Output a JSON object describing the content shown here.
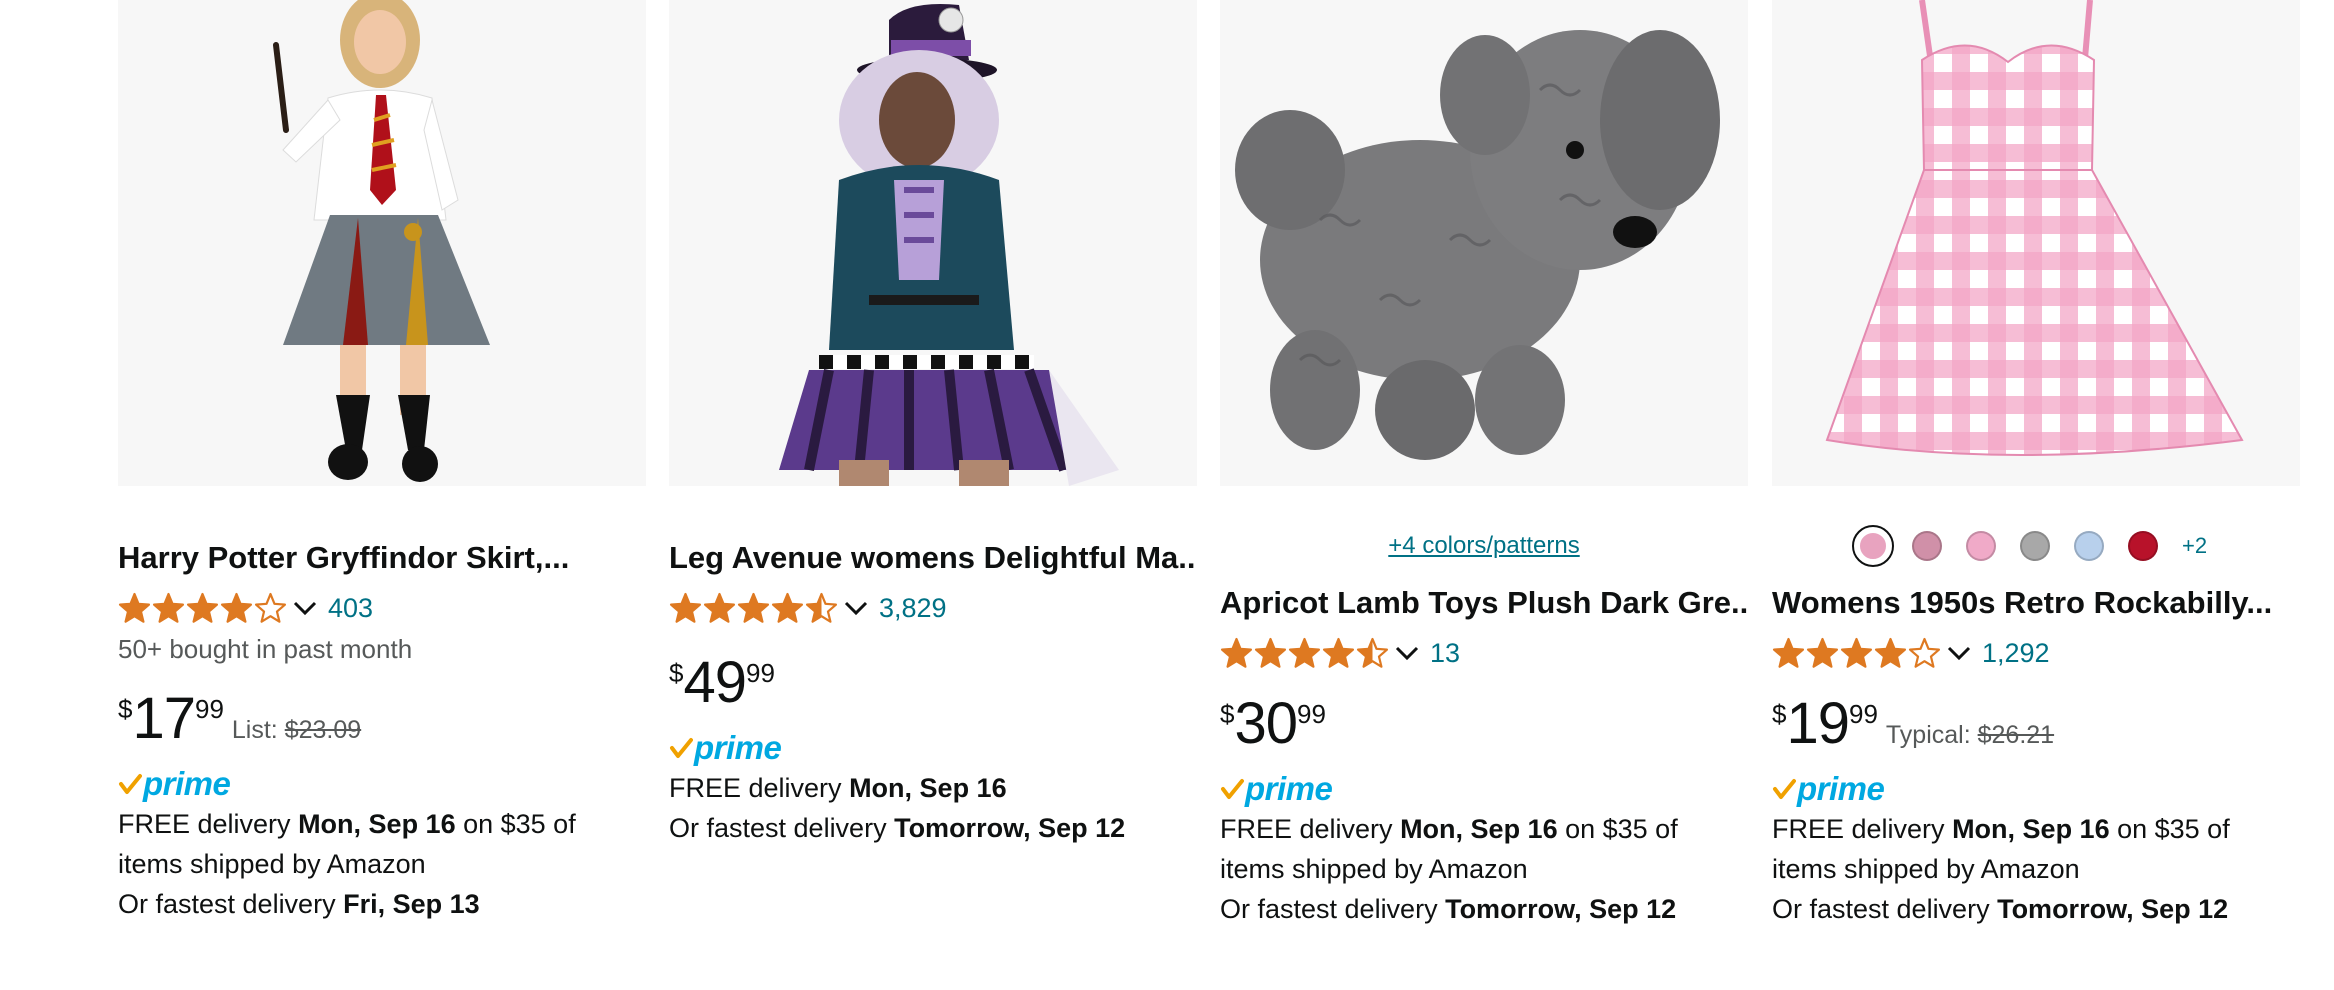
{
  "products": [
    {
      "title": "Harry Potter Gryffindor Skirt,...",
      "rating_value": 4.0,
      "rating_count": "403",
      "bought": "50+ bought in past month",
      "price_currency": "$",
      "price_whole": "17",
      "price_fraction": "99",
      "list_label": "List:",
      "list_price": "$23.09",
      "prime_label": "prime",
      "delivery_1_pre": "FREE delivery ",
      "delivery_1_bold": "Mon, Sep 16",
      "delivery_1_post": " on $35 of",
      "delivery_2": "items shipped by Amazon",
      "delivery_3_pre": "Or fastest delivery ",
      "delivery_3_bold": "Fri, Sep 13"
    },
    {
      "title": "Leg Avenue womens Delightful Ma...",
      "rating_value": 4.5,
      "rating_count": "3,829",
      "price_currency": "$",
      "price_whole": "49",
      "price_fraction": "99",
      "prime_label": "prime",
      "delivery_1_pre": "FREE delivery ",
      "delivery_1_bold": "Mon, Sep 16",
      "delivery_3_pre": "Or fastest delivery ",
      "delivery_3_bold": "Tomorrow, Sep 12"
    },
    {
      "colors_link": "+4 colors/patterns",
      "title": "Apricot Lamb Toys Plush Dark Gre...",
      "rating_value": 4.5,
      "rating_count": "13",
      "price_currency": "$",
      "price_whole": "30",
      "price_fraction": "99",
      "prime_label": "prime",
      "delivery_1_pre": "FREE delivery ",
      "delivery_1_bold": "Mon, Sep 16",
      "delivery_1_post": " on $35 of",
      "delivery_2": "items shipped by Amazon",
      "delivery_3_pre": "Or fastest delivery ",
      "delivery_3_bold": "Tomorrow, Sep 12"
    },
    {
      "swatches": [
        "#e8a3bf",
        "#d090a8",
        "#f0aac8",
        "#a8a8a8",
        "#b8d0ec",
        "#b8122a"
      ],
      "more_swatches": "+2",
      "title": "Womens 1950s Retro Rockabilly...",
      "rating_value": 4.0,
      "rating_count": "1,292",
      "price_currency": "$",
      "price_whole": "19",
      "price_fraction": "99",
      "list_label": "Typical:",
      "list_price": "$26.21",
      "prime_label": "prime",
      "delivery_1_pre": "FREE delivery ",
      "delivery_1_bold": "Mon, Sep 16",
      "delivery_1_post": " on $35 of",
      "delivery_2": "items shipped by Amazon",
      "delivery_3_pre": "Or fastest delivery ",
      "delivery_3_bold": "Tomorrow, Sep 12"
    }
  ],
  "colors": {
    "star": "#de7921",
    "link": "#007185",
    "prime_blue": "#00a8e1",
    "prime_check": "#f0a100",
    "text": "#0f1111",
    "muted": "#565959",
    "image_bg": "#f7f7f7"
  },
  "icons": {
    "star": "star-icon",
    "chevron": "chevron-down-icon",
    "prime_check": "prime-check-icon"
  }
}
